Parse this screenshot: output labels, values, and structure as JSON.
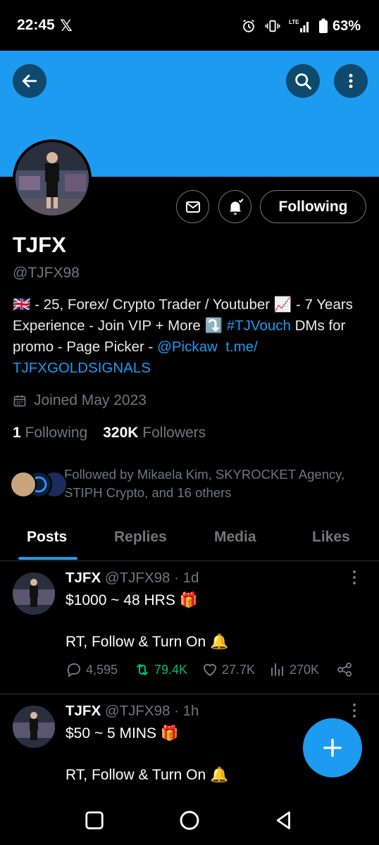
{
  "status_bar": {
    "time": "22:45",
    "app_logo": "𝕏",
    "battery_pct": "63%"
  },
  "profile": {
    "name": "TJFX",
    "handle": "@TJFX98",
    "bio_part1": "🇬🇧 - 25, Forex/ Crypto Trader / Youtuber 📈 - 7 Years Experience - Join VIP + More ⤵️ ",
    "bio_hashtag": "#TJVouch",
    "bio_part2": " DMs for promo - Page Picker - ",
    "bio_mention": "@Pickaw",
    "bio_gap": "  ",
    "bio_link": "t.me/ TJFXGOLDSIGNALS",
    "joined": "Joined May 2023",
    "following_count": "1",
    "following_label": "Following",
    "followers_count": "320K",
    "followers_label": "Followers",
    "followed_by": "Followed by Mikaela Kim, SKYROCKET Agency, STIPH Crypto, and 16 others",
    "follow_button": "Following"
  },
  "tabs": [
    "Posts",
    "Replies",
    "Media",
    "Likes"
  ],
  "posts": [
    {
      "name": "TJFX",
      "handle_time": "@TJFX98 · 1d",
      "line1": "$1000 ~ 48 HRS 🎁",
      "line2": "RT, Follow & Turn On 🔔",
      "replies": "4,595",
      "reposts": "79.4K",
      "likes": "27.7K",
      "views": "270K"
    },
    {
      "name": "TJFX",
      "handle_time": "@TJFX98 · 1h",
      "line1": "$50 ~ 5 MINS 🎁",
      "line2": "RT, Follow & Turn On 🔔"
    }
  ],
  "colors": {
    "accent": "#1d9bf0",
    "background": "#000000",
    "muted": "#71767b",
    "repost_green": "#00ba7c"
  },
  "icons": [
    "back-arrow-icon",
    "search-icon",
    "more-vertical-icon",
    "mail-icon",
    "bell-icon",
    "calendar-icon",
    "reply-icon",
    "repost-icon",
    "like-icon",
    "views-icon",
    "share-icon",
    "plus-icon",
    "alarm-icon",
    "vibrate-icon",
    "signal-icon",
    "battery-icon"
  ]
}
